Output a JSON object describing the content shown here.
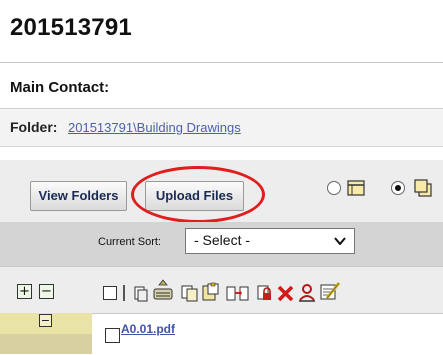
{
  "header": {
    "project_number": "201513791"
  },
  "contact": {
    "label": "Main Contact:"
  },
  "folder": {
    "label": "Folder:",
    "path": "201513791\\Building Drawings"
  },
  "toolbar": {
    "view_folders_label": "View Folders",
    "upload_files_label": "Upload Files",
    "view_mode": {
      "list_selected": false,
      "tile_selected": true
    }
  },
  "sort": {
    "label": "Current Sort:",
    "selected": "- Select -"
  },
  "actions": {
    "expand": "+",
    "collapse": "−",
    "icons": [
      "select-all-checkbox",
      "view-icon",
      "stamp-transfer-icon",
      "copy-icon",
      "paste-icon",
      "move-icon",
      "lock-icon",
      "delete-icon",
      "user-icon",
      "edit-icon"
    ]
  },
  "files": [
    {
      "name": "A0.01.pdf",
      "tree_toggle": "−"
    }
  ],
  "colors": {
    "link": "#4a62a8",
    "highlight_ellipse": "#e21d1d",
    "tree_cell": "#e9e3a8"
  }
}
